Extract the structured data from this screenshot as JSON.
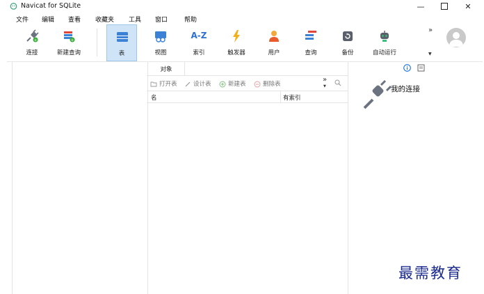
{
  "window": {
    "title": "Navicat for SQLite"
  },
  "menu": [
    "文件",
    "编辑",
    "查看",
    "收藏夹",
    "工具",
    "窗口",
    "帮助"
  ],
  "toolbar": {
    "connect": "连接",
    "new_query": "新建查询",
    "table": "表",
    "view": "视图",
    "index": "索引",
    "index_icon_text": "A-Z",
    "trigger": "触发器",
    "user": "用户",
    "query": "查询",
    "backup": "备份",
    "automation": "自动运行",
    "overflow": "»"
  },
  "center": {
    "tab_label": "对象",
    "actions": {
      "open_table": "打开表",
      "design_table": "设计表",
      "new_table": "新建表",
      "delete_table": "删除表"
    },
    "overflow": "»",
    "columns": [
      "名",
      "有索引"
    ]
  },
  "right": {
    "title": "我的连接"
  },
  "watermark": "最需教育",
  "colors": {
    "accent": "#1a73e8",
    "active_tool_bg": "#cfe4f7"
  }
}
